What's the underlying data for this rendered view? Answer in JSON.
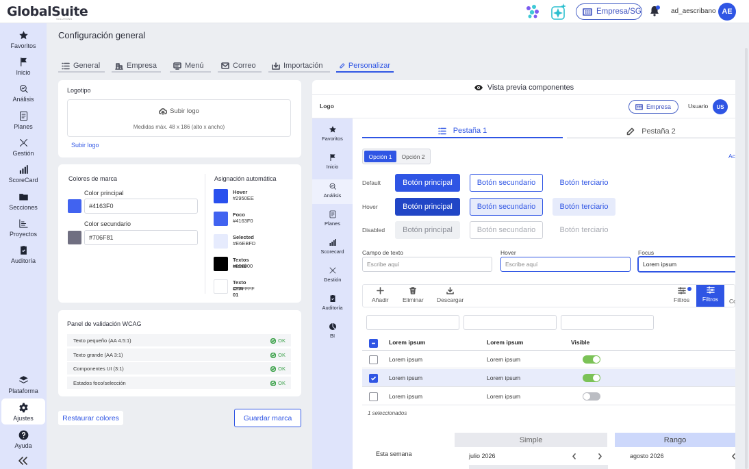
{
  "app": {
    "logo_text": "GlobalSuite",
    "logo_sub": "SOLUTIONS",
    "company_button": "Empresa/SG",
    "username": "ad_aescribano",
    "avatar_initials": "AE"
  },
  "colors": {
    "primary": "#4163F0",
    "secondary": "#706F81",
    "nav_bg": "#dfe4fb"
  },
  "sidebar": {
    "items": [
      {
        "label": "Favoritos",
        "icon": "star-icon"
      },
      {
        "label": "Inicio",
        "icon": "flag-icon"
      },
      {
        "label": "Análisis",
        "icon": "analysis-icon"
      },
      {
        "label": "Planes",
        "icon": "plans-icon"
      },
      {
        "label": "Gestión",
        "icon": "management-icon"
      },
      {
        "label": "ScoreCard",
        "icon": "bar-chart-icon"
      },
      {
        "label": "Secciones",
        "icon": "folder-icon"
      },
      {
        "label": "Proyectos",
        "icon": "projects-icon"
      },
      {
        "label": "Auditoría",
        "icon": "clipboard-icon"
      },
      {
        "label": "Plataforma",
        "icon": "layers-icon"
      },
      {
        "label": "Ajustes",
        "icon": "gear-icon"
      },
      {
        "label": "Ayuda",
        "icon": "help-icon"
      }
    ]
  },
  "page": {
    "title": "Configuración general"
  },
  "tabs": [
    {
      "label": "General",
      "icon": "list-icon"
    },
    {
      "label": "Empresa",
      "icon": "building-icon"
    },
    {
      "label": "Menú",
      "icon": "monitor-icon"
    },
    {
      "label": "Correo",
      "icon": "mail-icon"
    },
    {
      "label": "Importación",
      "icon": "import-icon"
    },
    {
      "label": "Personalizar",
      "icon": "pencil-icon",
      "active": true
    }
  ],
  "logo_card": {
    "title": "Logotipo",
    "upload_label": "Subir logo",
    "hint": "Medidas máx. 48 x 186 (alto x ancho)",
    "link": "Subir logo"
  },
  "brand_card": {
    "title": "Colores de marca",
    "primary_label": "Color principal",
    "primary_value": "#4163F0",
    "secondary_label": "Color secundario",
    "secondary_value": "#706F81",
    "assign_title": "Asignación automática",
    "assignments": [
      {
        "name": "Hover",
        "value": "#2950EE"
      },
      {
        "name": "Foco",
        "value": "#4163F0"
      },
      {
        "name": "Selected",
        "value": "#E6EBFD"
      },
      {
        "name": "Textos menú",
        "value": "#000000"
      },
      {
        "name": "Texto CTA 01",
        "value": "#FFFFFF"
      }
    ]
  },
  "wcag": {
    "title": "Panel de validación WCAG",
    "rows": [
      {
        "label": "Texto pequeño (AA 4.5:1)",
        "status": "OK"
      },
      {
        "label": "Texto grande (AA 3:1)",
        "status": "OK"
      },
      {
        "label": "Componentes UI (3:1)",
        "status": "OK"
      },
      {
        "label": "Estados foco/selección",
        "status": "OK"
      }
    ]
  },
  "actions": {
    "restore": "Restaurar colores",
    "save": "Guardar marca"
  },
  "preview": {
    "title": "Vista previa componentes",
    "logo": "Logo",
    "company": "Empresa",
    "user_label": "Usuario",
    "avatar": "US",
    "nav": [
      "Favoritos",
      "Inicio",
      "Análisis",
      "Planes",
      "Scorecard",
      "Gestión",
      "Auditoría",
      "BI"
    ],
    "tab1": "Pestaña 1",
    "tab2": "Pestaña 2",
    "seg1": "Opción 1",
    "seg2": "Opción 2",
    "acc_text": "Ac",
    "rows": {
      "default": "Default",
      "hover": "Hover",
      "disabled": "Disabled"
    },
    "btn_primary": "Botón principal",
    "btn_secondary": "Botón secundario",
    "btn_tertiary": "Botón terciario",
    "fields": [
      {
        "label": "Campo de texto",
        "value": "Escribe aquí"
      },
      {
        "label": "Hover",
        "value": "Escribe aquí"
      },
      {
        "label": "Focus",
        "value": "Lorem ipsum"
      }
    ],
    "toolbar": {
      "add": "Añadir",
      "delete": "Eliminar",
      "download": "Descargar",
      "filters": "Filtros",
      "filters_active": "Filtros",
      "more": "Co"
    },
    "table": {
      "headers": [
        "Lorem ipsum",
        "Lorem ipsum",
        "Visible"
      ],
      "rows": [
        {
          "c1": "Lorem ipsum",
          "c2": "Lorem ipsum",
          "checked": false,
          "visible": true
        },
        {
          "c1": "Lorem ipsum",
          "c2": "Lorem ipsum",
          "checked": true,
          "visible": true
        },
        {
          "c1": "Lorem ipsum",
          "c2": "Lorem ipsum",
          "checked": false,
          "visible": false
        }
      ],
      "selected_count": "1 seleccionados"
    },
    "date": {
      "week": "Esta semana",
      "simple": "Simple",
      "range": "Rango",
      "month1": "julio 2026",
      "month2": "agosto 2026"
    }
  }
}
